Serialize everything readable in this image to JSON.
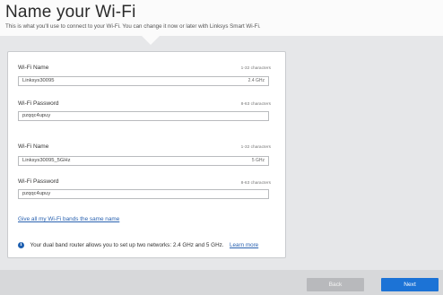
{
  "header": {
    "title": "Name your Wi-Fi",
    "subtitle": "This is what you'll use to connect to your Wi-Fi. You can change it now or later with Linksys Smart Wi-Fi."
  },
  "networks": [
    {
      "name_label": "Wi-Fi Name",
      "name_hint": "1-32 characters",
      "name_value": "Linksys30095",
      "band": "2.4 GHz",
      "password_label": "Wi-Fi Password",
      "password_hint": "8-63 characters",
      "password_value": "pzqqc4upuy"
    },
    {
      "name_label": "Wi-Fi Name",
      "name_hint": "1-32 characters",
      "name_value": "Linksys30095_5GHz",
      "band": "5 GHz",
      "password_label": "Wi-Fi Password",
      "password_hint": "8-63 characters",
      "password_value": "pzqqc4upuy"
    }
  ],
  "same_name_link": "Give all my Wi-Fi bands the same name",
  "info": {
    "text": "Your dual band router allows you to set up two networks: 2.4 GHz and 5 GHz.",
    "link": "Learn more",
    "icon": "info-icon"
  },
  "footer": {
    "back_label": "Back",
    "next_label": "Next"
  },
  "colors": {
    "accent": "#1c73d6",
    "link": "#2a62b0",
    "background": "#e6e7e9"
  }
}
